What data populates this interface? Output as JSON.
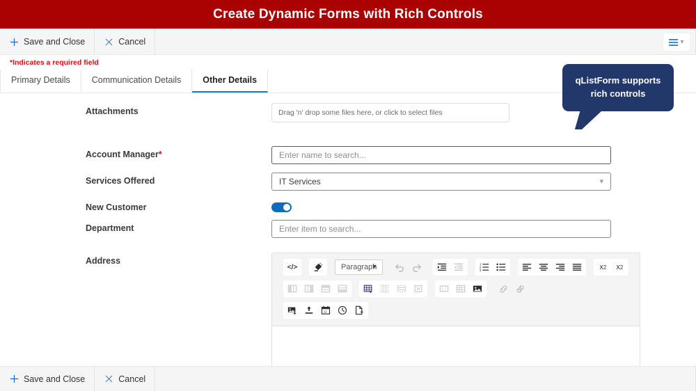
{
  "banner": {
    "title": "Create Dynamic Forms with Rich Controls"
  },
  "commandbar": {
    "save_label": "Save and Close",
    "cancel_label": "Cancel",
    "plus_icon": "plus-icon",
    "x_icon": "close-icon",
    "menu_icon": "hamburger-icon",
    "chevron_icon": "chevron-down-icon"
  },
  "required_note": "*Indicates a required field",
  "tabs": [
    {
      "label": "Primary Details",
      "active": false
    },
    {
      "label": "Communication Details",
      "active": false
    },
    {
      "label": "Other Details",
      "active": true
    }
  ],
  "fields": {
    "attachments": {
      "label": "Attachments",
      "dropzone_text": "Drag 'n' drop some files here, or click to select files"
    },
    "account_manager": {
      "label": "Account Manager",
      "required_marker": "*",
      "placeholder": "Enter name to search..."
    },
    "services_offered": {
      "label": "Services Offered",
      "value": "IT Services",
      "chevron": "⌄"
    },
    "new_customer": {
      "label": "New Customer",
      "state": "on"
    },
    "department": {
      "label": "Department",
      "placeholder": "Enter item to search..."
    },
    "address": {
      "label": "Address",
      "content": ""
    }
  },
  "editor": {
    "paragraph_label": "Paragraph",
    "rows": [
      {
        "groups": [
          {
            "buttons": [
              {
                "name": "source-code-icon",
                "enabled": true
              }
            ]
          },
          {
            "buttons": [
              {
                "name": "remove-format-icon",
                "enabled": true
              }
            ]
          },
          {
            "dropdown": "Paragraph"
          },
          {
            "flat": true,
            "buttons": [
              {
                "name": "undo-icon",
                "enabled": false
              },
              {
                "name": "redo-icon",
                "enabled": false
              }
            ]
          },
          {
            "buttons": [
              {
                "name": "indent-increase-icon",
                "enabled": true
              },
              {
                "name": "indent-decrease-icon",
                "enabled": false
              }
            ]
          },
          {
            "buttons": [
              {
                "name": "ordered-list-icon",
                "enabled": true
              },
              {
                "name": "bulleted-list-icon",
                "enabled": true
              }
            ]
          },
          {
            "buttons": [
              {
                "name": "align-left-icon",
                "enabled": true
              },
              {
                "name": "align-center-icon",
                "enabled": true
              },
              {
                "name": "align-right-icon",
                "enabled": true
              },
              {
                "name": "align-justify-icon",
                "enabled": true
              }
            ]
          },
          {
            "buttons": [
              {
                "name": "subscript-icon",
                "enabled": true
              },
              {
                "name": "superscript-icon",
                "enabled": true
              }
            ]
          }
        ]
      },
      {
        "groups": [
          {
            "buttons": [
              {
                "name": "table-insert-column-left-icon",
                "enabled": false
              },
              {
                "name": "table-insert-column-right-icon",
                "enabled": false
              },
              {
                "name": "table-insert-row-above-icon",
                "enabled": false
              },
              {
                "name": "table-insert-row-below-icon",
                "enabled": false
              }
            ]
          },
          {
            "buttons": [
              {
                "name": "table-icon",
                "enabled": true
              },
              {
                "name": "table-delete-column-icon",
                "enabled": false
              },
              {
                "name": "table-delete-row-icon",
                "enabled": false
              },
              {
                "name": "table-delete-icon",
                "enabled": false
              }
            ]
          },
          {
            "buttons": [
              {
                "name": "table-merge-cells-icon",
                "enabled": false
              },
              {
                "name": "table-properties-icon",
                "enabled": false
              },
              {
                "name": "image-icon",
                "enabled": true
              }
            ]
          },
          {
            "flat": true,
            "buttons": [
              {
                "name": "link-icon",
                "enabled": false
              },
              {
                "name": "unlink-icon",
                "enabled": false
              }
            ]
          }
        ]
      },
      {
        "groups": [
          {
            "buttons": [
              {
                "name": "insert-image-icon",
                "enabled": true
              },
              {
                "name": "upload-icon",
                "enabled": true
              },
              {
                "name": "calendar-icon",
                "enabled": true
              },
              {
                "name": "clock-icon",
                "enabled": true
              },
              {
                "name": "new-document-icon",
                "enabled": true
              }
            ]
          }
        ]
      }
    ]
  },
  "callout": {
    "line1": "qListForm supports",
    "line2": "rich controls"
  },
  "footer": {
    "save_label": "Save and Close",
    "cancel_label": "Cancel"
  },
  "colors": {
    "banner": "#aa0202",
    "accent_blue": "#1a7ac9",
    "toggle_on": "#0f6cbd",
    "required_red": "#d01414",
    "callout_bg": "#22386b"
  }
}
